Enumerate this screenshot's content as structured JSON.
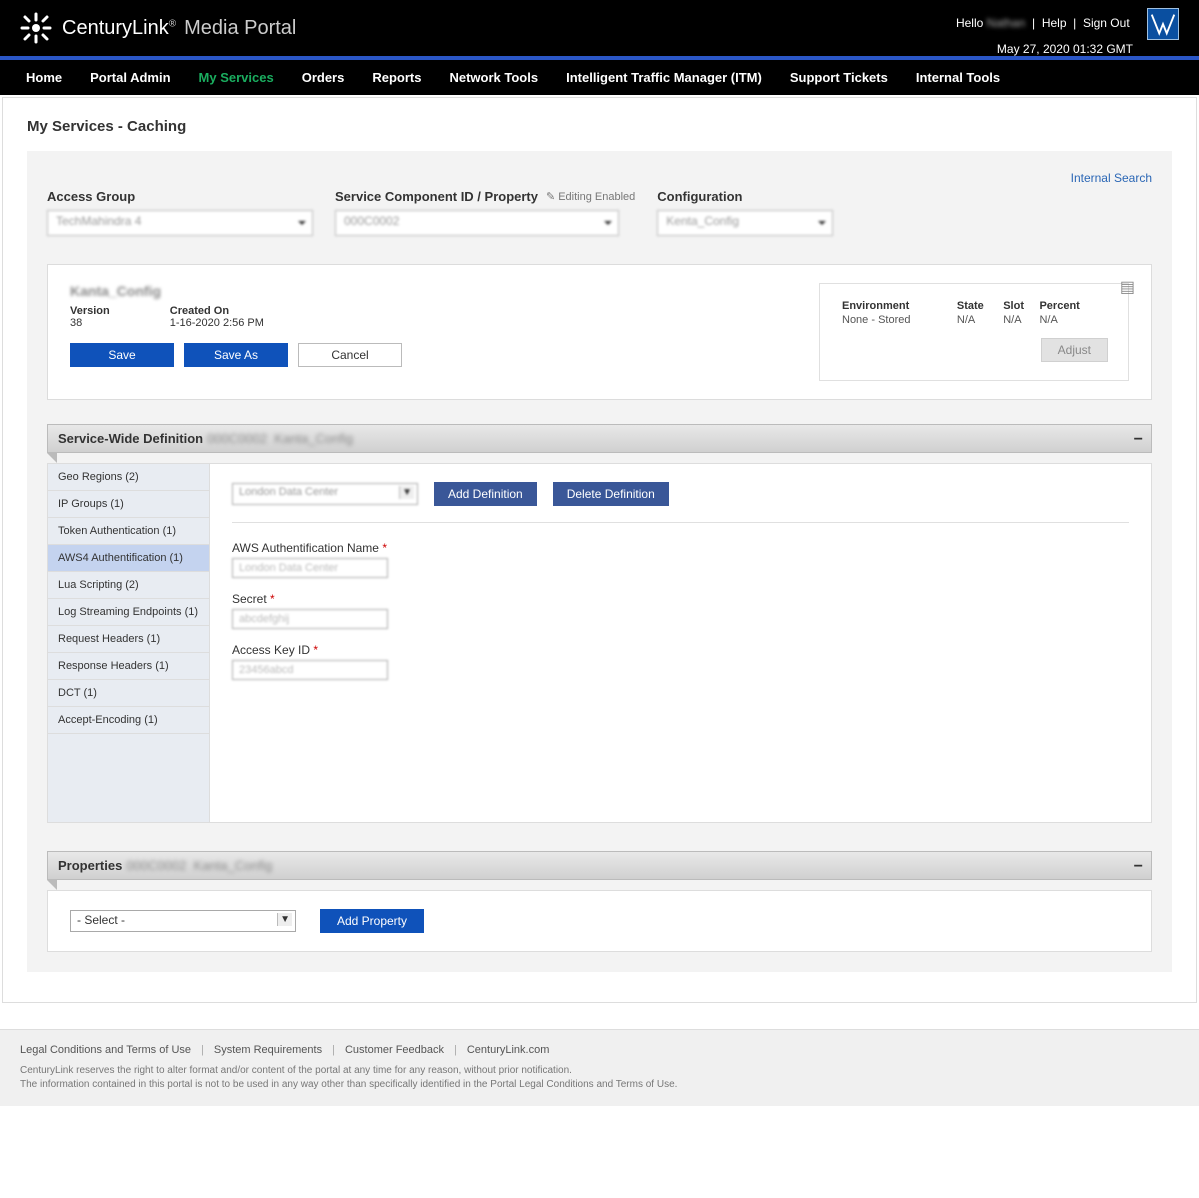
{
  "header": {
    "brand": "CenturyLink",
    "brand_suffix": "®",
    "product": "Media Portal",
    "hello": "Hello",
    "username": "(redacted)",
    "help_label": "Help",
    "signout_label": "Sign Out",
    "timestamp": "May 27, 2020 01:32 GMT",
    "vyvx_label": "Vyvx"
  },
  "nav": {
    "items": [
      {
        "label": "Home"
      },
      {
        "label": "Portal Admin"
      },
      {
        "label": "My Services",
        "active": true
      },
      {
        "label": "Orders"
      },
      {
        "label": "Reports"
      },
      {
        "label": "Network Tools"
      },
      {
        "label": "Intelligent Traffic Manager (ITM)"
      },
      {
        "label": "Support Tickets"
      },
      {
        "label": "Internal Tools"
      }
    ]
  },
  "page_title": "My Services - Caching",
  "internal_search": "Internal Search",
  "filters": {
    "access_group": {
      "label": "Access Group",
      "value": "(redacted)"
    },
    "service_component": {
      "label": "Service Component ID / Property",
      "editing_label": "Editing Enabled",
      "value": "(redacted)"
    },
    "configuration": {
      "label": "Configuration",
      "value": "(redacted)"
    }
  },
  "config": {
    "title": "(Config name redacted)",
    "version_label": "Version",
    "version_value": "38",
    "created_label": "Created On",
    "created_value": "1-16-2020 2:56 PM",
    "save": "Save",
    "save_as": "Save As",
    "cancel": "Cancel",
    "env": {
      "environment_h": "Environment",
      "state_h": "State",
      "slot_h": "Slot",
      "percent_h": "Percent",
      "environment_v": "None - Stored",
      "state_v": "N/A",
      "slot_v": "N/A",
      "percent_v": "N/A",
      "adjust": "Adjust"
    }
  },
  "section_service_wide": {
    "title": "Service-Wide Definition",
    "subtitle": "(redacted)  (config)"
  },
  "side_tabs": [
    {
      "label": "Geo Regions (2)"
    },
    {
      "label": "IP Groups (1)"
    },
    {
      "label": "Token Authentication (1)"
    },
    {
      "label": "AWS4 Authentification (1)",
      "active": true
    },
    {
      "label": "Lua Scripting (2)"
    },
    {
      "label": "Log Streaming Endpoints (1)"
    },
    {
      "label": "Request Headers (1)"
    },
    {
      "label": "Response Headers (1)"
    },
    {
      "label": "DCT (1)"
    },
    {
      "label": "Accept-Encoding (1)"
    }
  ],
  "form": {
    "definition_select": "(redacted)",
    "add_definition": "Add Definition",
    "delete_definition": "Delete Definition",
    "auth_name_label": "AWS Authentification Name",
    "auth_name_value": "(redacted)",
    "secret_label": "Secret",
    "secret_value": "(redacted)",
    "access_key_label": "Access Key ID",
    "access_key_value": "(redacted)"
  },
  "section_properties": {
    "title": "Properties",
    "subtitle": "(redacted)  (config)",
    "select_value": "- Select -",
    "add_property": "Add Property"
  },
  "footer": {
    "links": [
      "Legal Conditions and Terms of Use",
      "System Requirements",
      "Customer Feedback",
      "CenturyLink.com"
    ],
    "disclaimer1": "CenturyLink reserves the right to alter format and/or content of the portal at any time for any reason, without prior notification.",
    "disclaimer2": "The information contained in this portal is not to be used in any way other than specifically identified in the Portal Legal Conditions and Terms of Use."
  }
}
